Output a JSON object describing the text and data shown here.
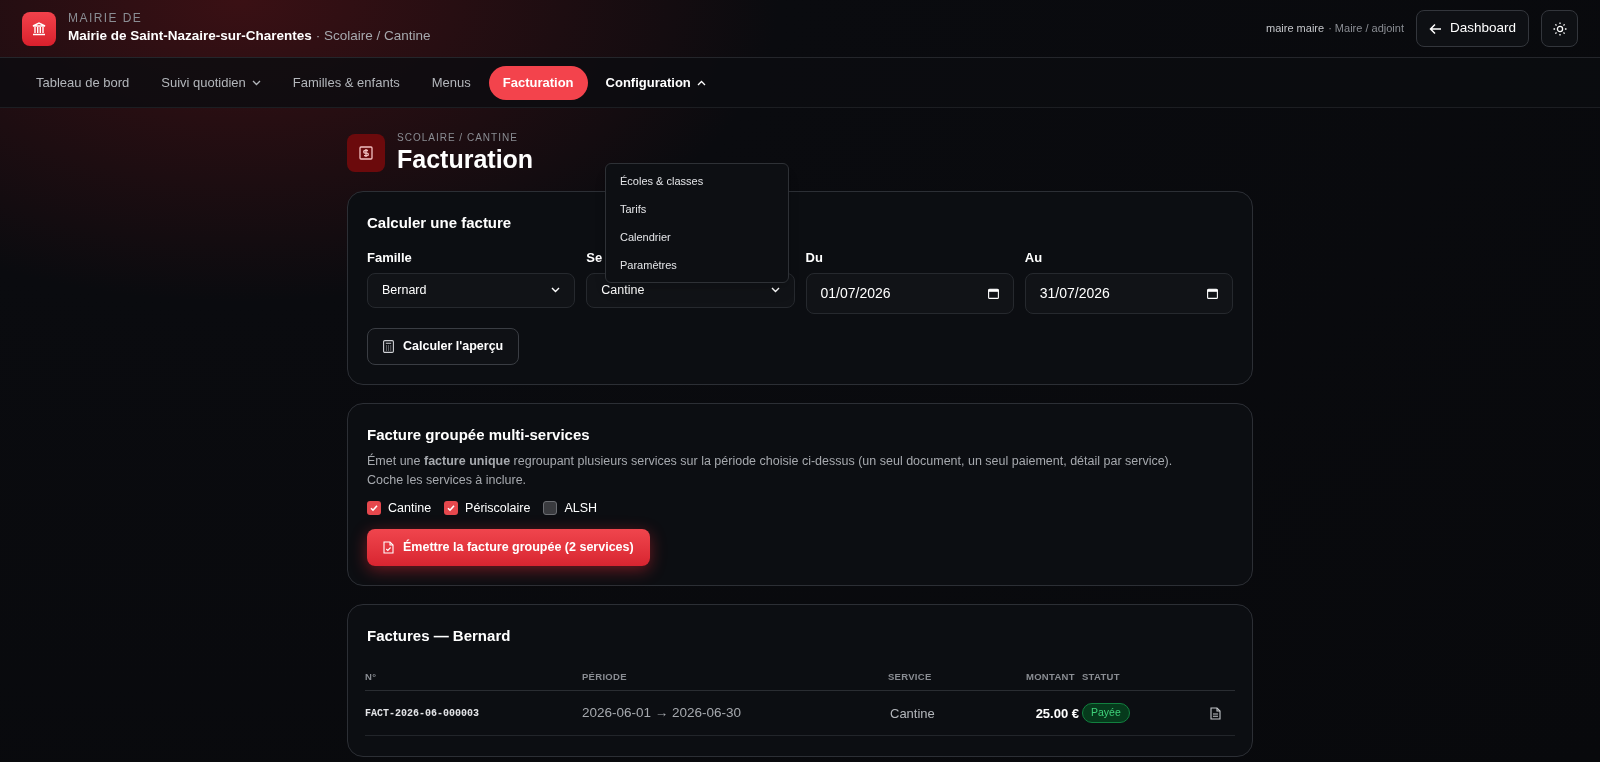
{
  "header": {
    "eyebrow": "MAIRIE DE",
    "org": "Mairie de Saint-Nazaire-sur-Charentes",
    "context": "· Scolaire / Cantine",
    "user": "maire maire",
    "role": "· Maire / adjoint",
    "dashboard_button": "Dashboard"
  },
  "nav": [
    {
      "label": "Tableau de bord",
      "selected": false,
      "has_menu": false,
      "expanded": false
    },
    {
      "label": "Suivi quotidien",
      "selected": false,
      "has_menu": true,
      "expanded": false
    },
    {
      "label": "Familles & enfants",
      "selected": false,
      "has_menu": false,
      "expanded": false
    },
    {
      "label": "Menus",
      "selected": false,
      "has_menu": false,
      "expanded": false
    },
    {
      "label": "Facturation",
      "selected": true,
      "has_menu": false,
      "expanded": false
    },
    {
      "label": "Configuration",
      "selected": false,
      "has_menu": true,
      "expanded": true
    }
  ],
  "config_menu": [
    "Écoles & classes",
    "Tarifs",
    "Calendrier",
    "Paramètres"
  ],
  "page": {
    "breadcrumb": "SCOLAIRE / CANTINE",
    "title": "Facturation"
  },
  "calc": {
    "title": "Calculer une facture",
    "fields": [
      {
        "kind": "select",
        "label": "Famille",
        "value": "Bernard"
      },
      {
        "kind": "select",
        "label": "Se",
        "value": "Cantine"
      },
      {
        "kind": "date",
        "label": "Du",
        "value": "01/07/2026"
      },
      {
        "kind": "date",
        "label": "Au",
        "value": "31/07/2026"
      }
    ],
    "button": "Calculer l'aperçu"
  },
  "grouped": {
    "title": "Facture groupée multi-services",
    "description": "Émet une **facture unique** regroupant plusieurs services sur la période choisie ci-dessus (un seul document, un seul paiement, détail par service).",
    "hint": "Coche les services à inclure.",
    "services": [
      {
        "label": "Cantine",
        "checked": true
      },
      {
        "label": "Périscolaire",
        "checked": true
      },
      {
        "label": "ALSH",
        "checked": false
      }
    ],
    "button": "Émettre la facture groupée (2 services)"
  },
  "invoices": {
    "title": "Factures — Bernard",
    "columns": [
      "N°",
      "PÉRIODE",
      "SERVICE",
      "MONTANT",
      "STATUT"
    ],
    "rows": [
      {
        "number": "FACT-2026-06-000003",
        "period": "2026-06-01 → 2026-06-30",
        "service": "Cantine",
        "amount": "25.00 €",
        "status": "Payée"
      }
    ]
  }
}
